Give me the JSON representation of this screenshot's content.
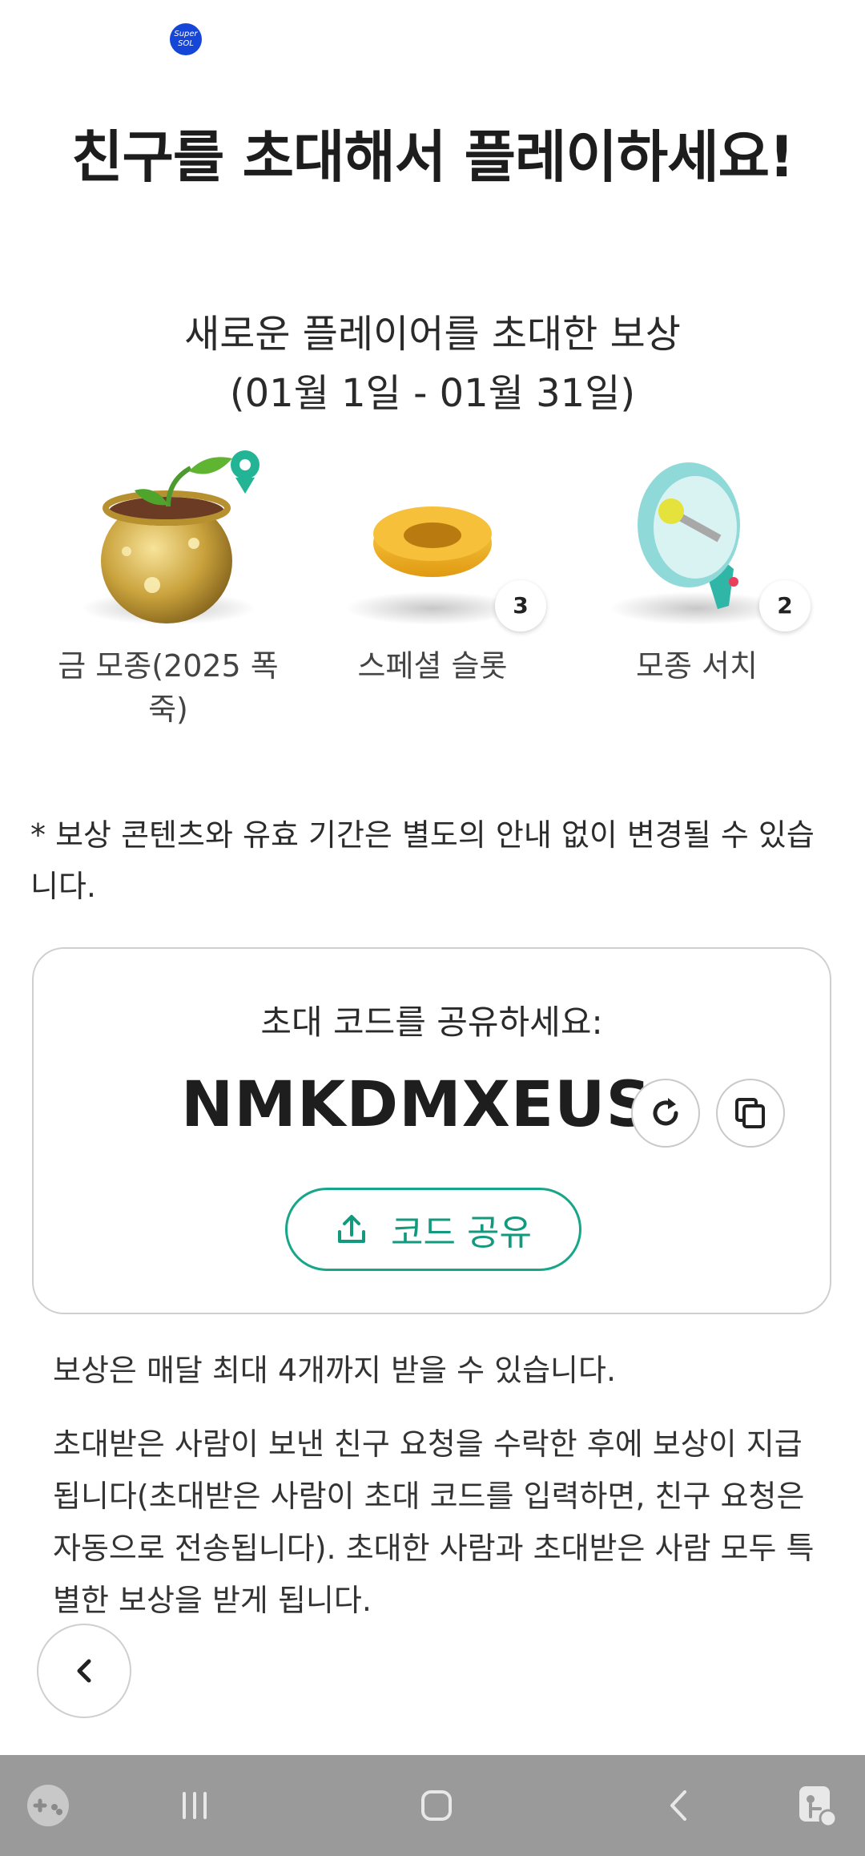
{
  "status_bar": {
    "app_badge_text": "Super SOL"
  },
  "page": {
    "title": "친구를 초대해서 플레이하세요!",
    "subtitle_line1": "새로운 플레이어를 초대한 보상",
    "subtitle_line2": "(01월 1일 - 01월 31일)"
  },
  "rewards": [
    {
      "label": "금 모종(2025 폭죽)",
      "icon": "golden-pot-icon",
      "count": ""
    },
    {
      "label": "스페셜 슬롯",
      "icon": "special-slot-icon",
      "count": "3"
    },
    {
      "label": "모종 서치",
      "icon": "megaphone-icon",
      "count": "2"
    }
  ],
  "note": "* 보상 콘텐츠와 유효 기간은 별도의 안내 없이 변경될 수 있습니다.",
  "invite_card": {
    "heading": "초대 코드를 공유하세요:",
    "code": "NMKDMXEUS",
    "share_label": "코드 공유"
  },
  "info": {
    "monthly_limit": "보상은 매달 최대 4개까지 받을 수 있습니다.",
    "details": "초대받은 사람이 보낸 친구 요청을 수락한 후에 보상이 지급됩니다(초대받은 사람이 초대 코드를 입력하면, 친구 요청은 자동으로 전송됩니다). 초대한 사람과 초대받은 사람 모두 특별한 보상을 받게 됩니다."
  },
  "colors": {
    "accent_green": "#18a689",
    "navbar_gray": "#9a9a9a",
    "badge_blue": "#1646d8"
  }
}
